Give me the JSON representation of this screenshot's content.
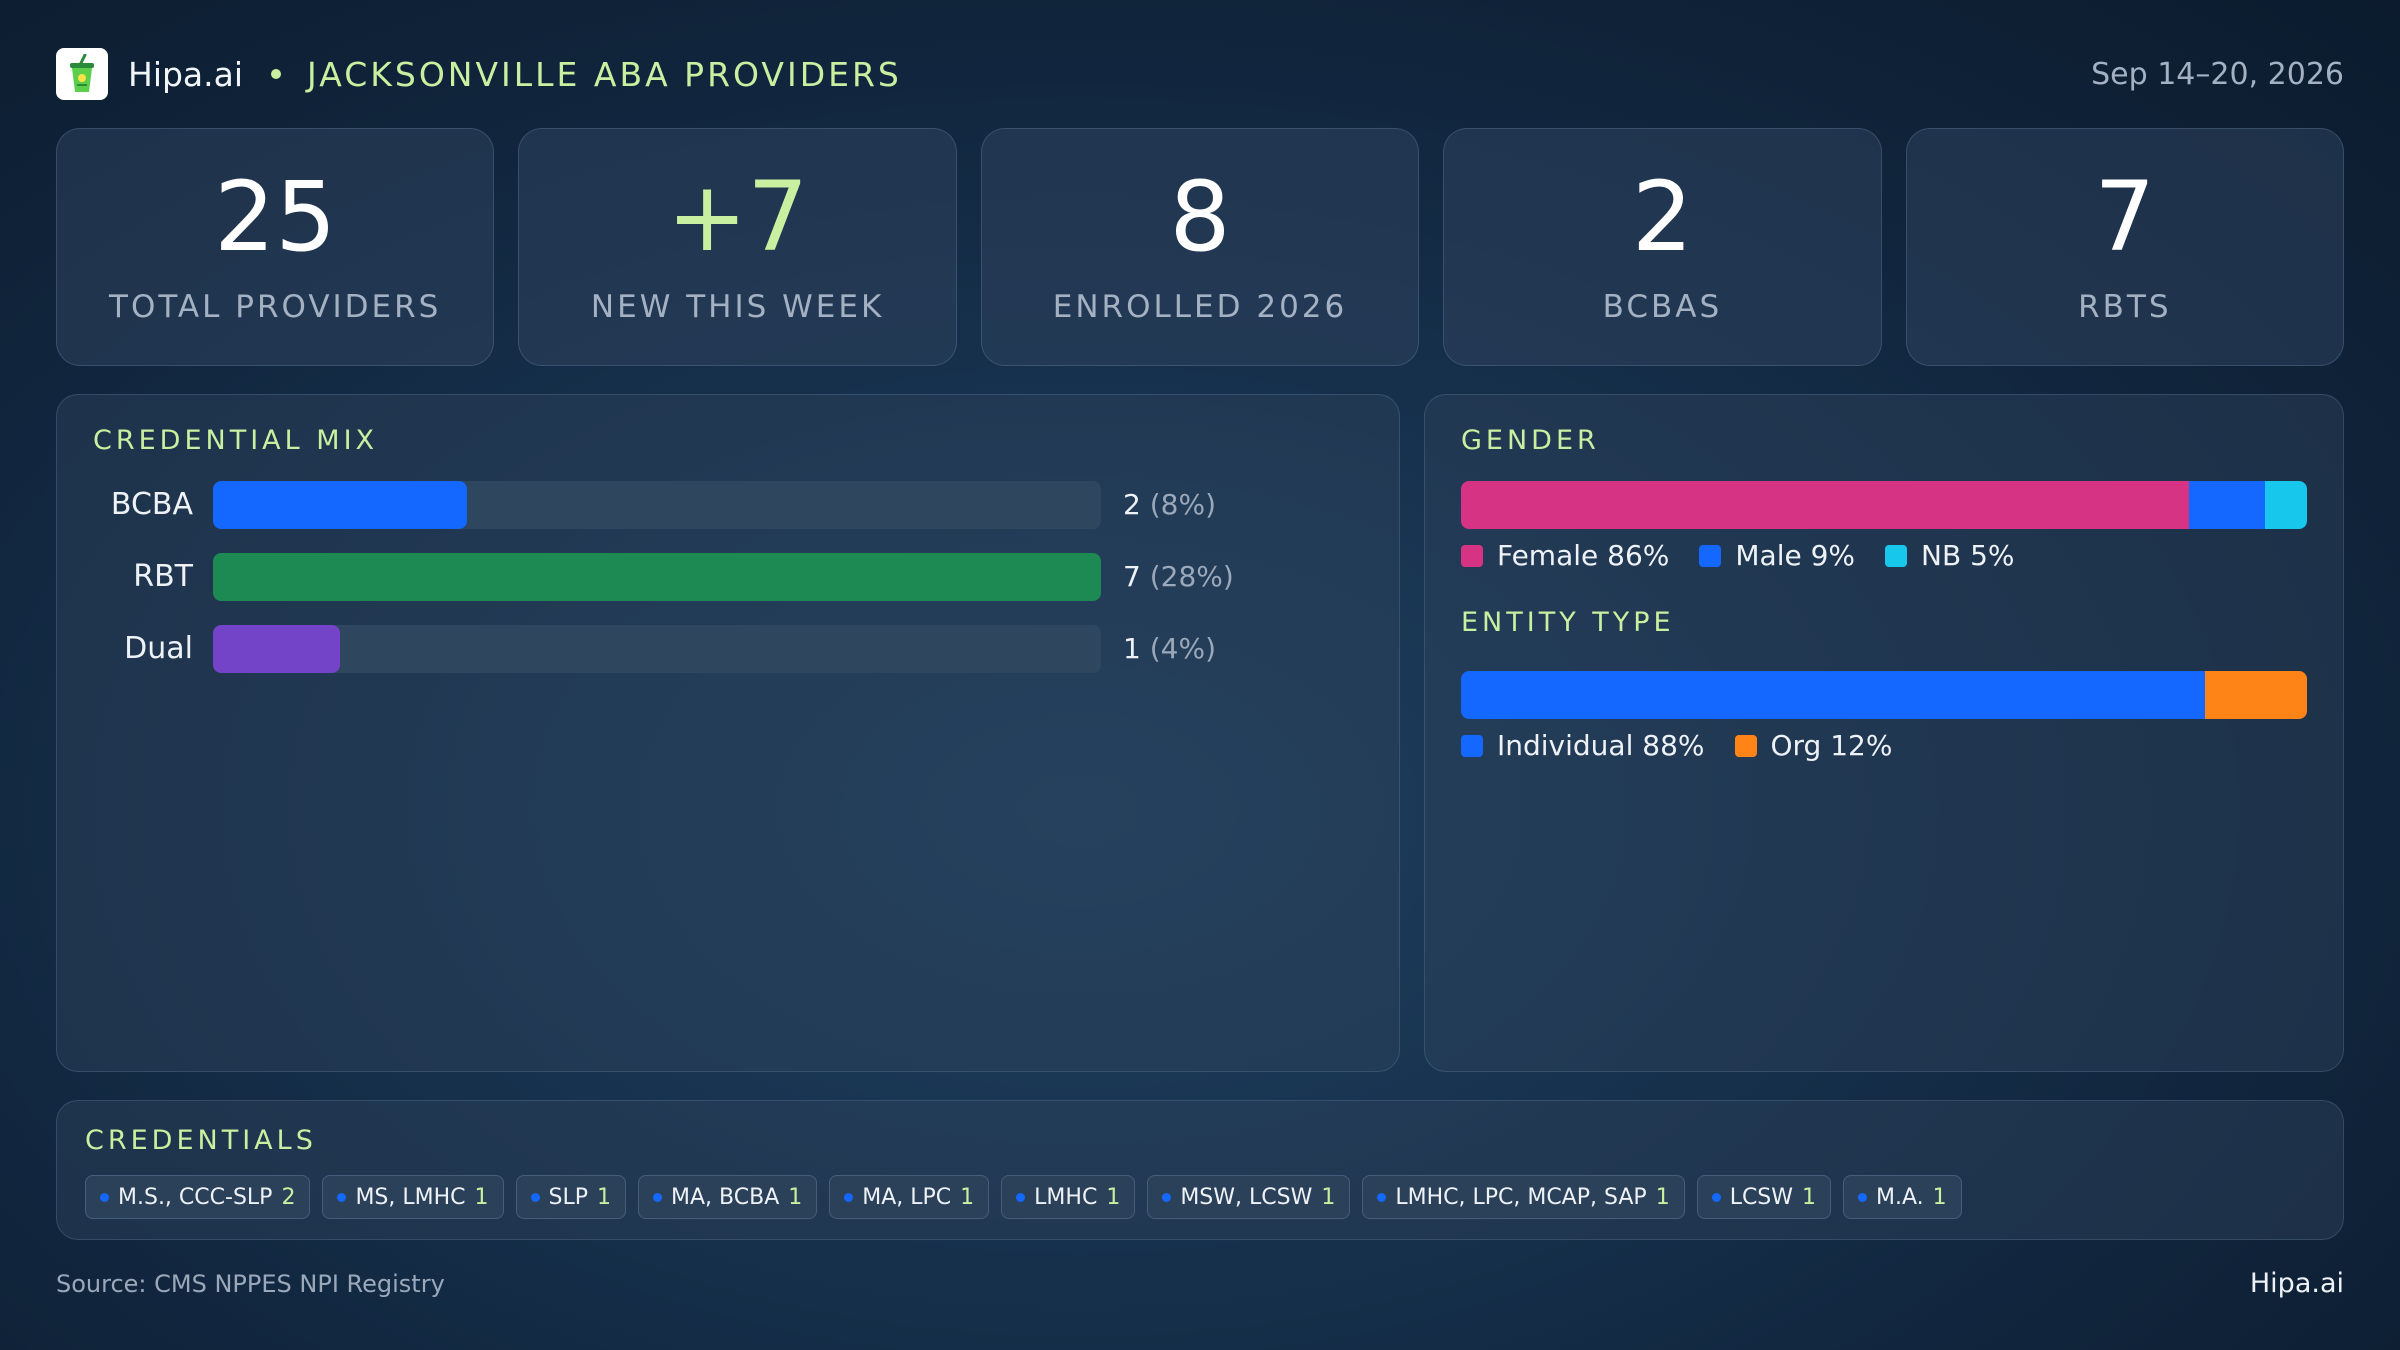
{
  "header": {
    "brand": "Hipa.ai",
    "title": "JACKSONVILLE ABA PROVIDERS",
    "date_range": "Sep 14–20, 2026",
    "logo_icon": "drink-cup-icon"
  },
  "kpis": [
    {
      "value": "25",
      "label": "TOTAL PROVIDERS"
    },
    {
      "value": "+7",
      "label": "NEW THIS WEEK"
    },
    {
      "value": "8",
      "label": "ENROLLED 2026"
    },
    {
      "value": "2",
      "label": "BCBAS"
    },
    {
      "value": "7",
      "label": "RBTS"
    }
  ],
  "credential_mix": {
    "title": "CREDENTIAL MIX",
    "rows": [
      {
        "label": "BCBA",
        "count": "2",
        "pct_text": "(8%)",
        "pct": 8,
        "color": "#1467ff"
      },
      {
        "label": "RBT",
        "count": "7",
        "pct_text": "(28%)",
        "pct": 28,
        "color": "#1c8a52"
      },
      {
        "label": "Dual",
        "count": "1",
        "pct_text": "(4%)",
        "pct": 4,
        "color": "#7444c8"
      }
    ]
  },
  "gender": {
    "title": "GENDER",
    "segments": [
      {
        "label": "Female 86%",
        "pct": 86,
        "color": "#d63384"
      },
      {
        "label": "Male 9%",
        "pct": 9,
        "color": "#1467ff"
      },
      {
        "label": "NB 5%",
        "pct": 5,
        "color": "#17c8ec"
      }
    ]
  },
  "entity_type": {
    "title": "ENTITY TYPE",
    "segments": [
      {
        "label": "Individual 88%",
        "pct": 88,
        "color": "#1467ff"
      },
      {
        "label": "Org 12%",
        "pct": 12,
        "color": "#ff8418"
      }
    ]
  },
  "credentials": {
    "title": "CREDENTIALS",
    "tags": [
      {
        "label": "M.S., CCC-SLP",
        "count": "2"
      },
      {
        "label": "MS, LMHC",
        "count": "1"
      },
      {
        "label": "SLP",
        "count": "1"
      },
      {
        "label": "MA, BCBA",
        "count": "1"
      },
      {
        "label": "MA, LPC",
        "count": "1"
      },
      {
        "label": "LMHC",
        "count": "1"
      },
      {
        "label": "MSW, LCSW",
        "count": "1"
      },
      {
        "label": "LMHC, LPC, MCAP, SAP",
        "count": "1"
      },
      {
        "label": "LCSW",
        "count": "1"
      },
      {
        "label": "M.A.",
        "count": "1"
      }
    ]
  },
  "footer": {
    "source": "Source: CMS NPPES NPI Registry",
    "brand": "Hipa.ai"
  }
}
